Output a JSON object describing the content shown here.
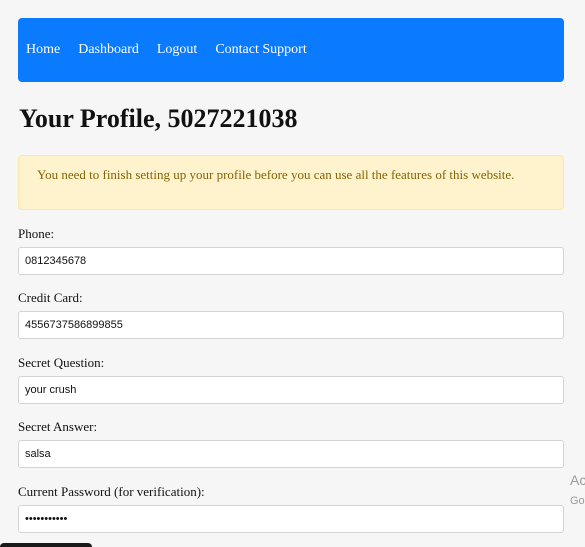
{
  "nav": {
    "links": [
      "Home",
      "Dashboard",
      "Logout",
      "Contact Support"
    ]
  },
  "page_title": "Your Profile, 5027221038",
  "alert": {
    "message": "You need to finish setting up your profile before you can use all the features of this website."
  },
  "form": {
    "phone": {
      "label": "Phone:",
      "value": "0812345678"
    },
    "credit_card": {
      "label": "Credit Card:",
      "value": "4556737586899855"
    },
    "secret_question": {
      "label": "Secret Question:",
      "value": "your crush"
    },
    "secret_answer": {
      "label": "Secret Answer:",
      "value": "salsa"
    },
    "current_password": {
      "label": "Current Password (for verification):",
      "value": "•••••••••••"
    }
  },
  "watermark": {
    "line1": "Ac",
    "line2": "Go"
  },
  "colors": {
    "navbar": "#0a7bff",
    "alert_bg": "#fff3cd",
    "alert_text": "#856404"
  }
}
